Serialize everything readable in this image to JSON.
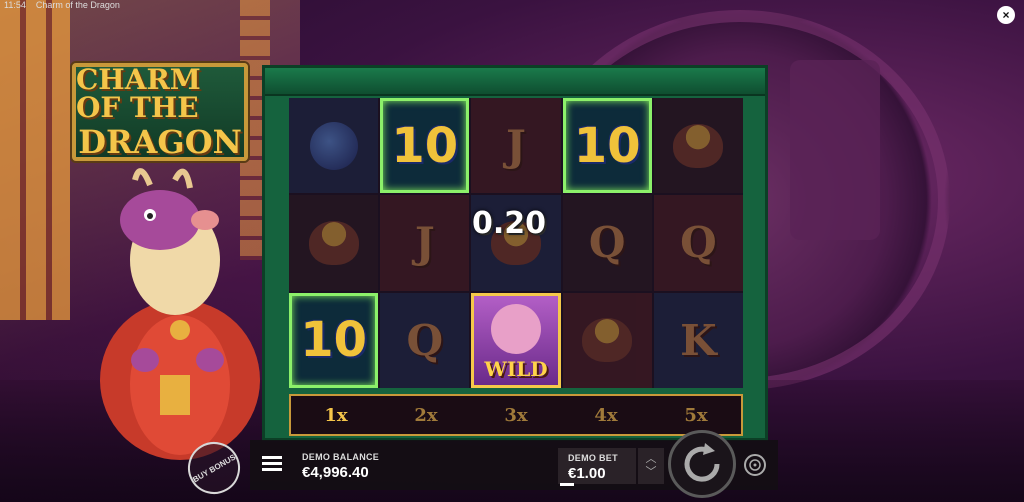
{
  "topbar": {
    "time": "11:54",
    "window_title": "Charm of the Dragon"
  },
  "close_icon": "close-icon",
  "logo": {
    "line1": "CHARM OF THE",
    "line2": "DRAGON"
  },
  "reels": [
    [
      {
        "symbol": "orb",
        "label": ""
      },
      {
        "symbol": "pot",
        "label": ""
      },
      {
        "symbol": "ten",
        "label": "10",
        "win": true
      }
    ],
    [
      {
        "symbol": "ten",
        "label": "10",
        "win": true
      },
      {
        "symbol": "letter",
        "label": "J"
      },
      {
        "symbol": "letter",
        "label": "Q"
      }
    ],
    [
      {
        "symbol": "letter",
        "label": "J"
      },
      {
        "symbol": "pot",
        "label": ""
      },
      {
        "symbol": "wild",
        "label": "WILD",
        "win": true
      }
    ],
    [
      {
        "symbol": "ten",
        "label": "10",
        "win": true
      },
      {
        "symbol": "letter",
        "label": "Q"
      },
      {
        "symbol": "pot",
        "label": ""
      }
    ],
    [
      {
        "symbol": "pot",
        "label": ""
      },
      {
        "symbol": "letter",
        "label": "Q"
      },
      {
        "symbol": "letter",
        "label": "K"
      }
    ]
  ],
  "win_amount": "0.20",
  "multipliers": [
    {
      "label": "1x",
      "active": true
    },
    {
      "label": "2x",
      "active": false
    },
    {
      "label": "3x",
      "active": false
    },
    {
      "label": "4x",
      "active": false
    },
    {
      "label": "5x",
      "active": false
    }
  ],
  "buy_bonus_label": "BUY BONUS",
  "hud": {
    "balance_label": "DEMO BALANCE",
    "balance_value": "€4,996.40",
    "bet_label": "DEMO BET",
    "bet_value": "€1.00"
  },
  "colors": {
    "win_border": "#8cf06a",
    "gold": "#f4c54a",
    "reel_frame": "#15633e"
  }
}
